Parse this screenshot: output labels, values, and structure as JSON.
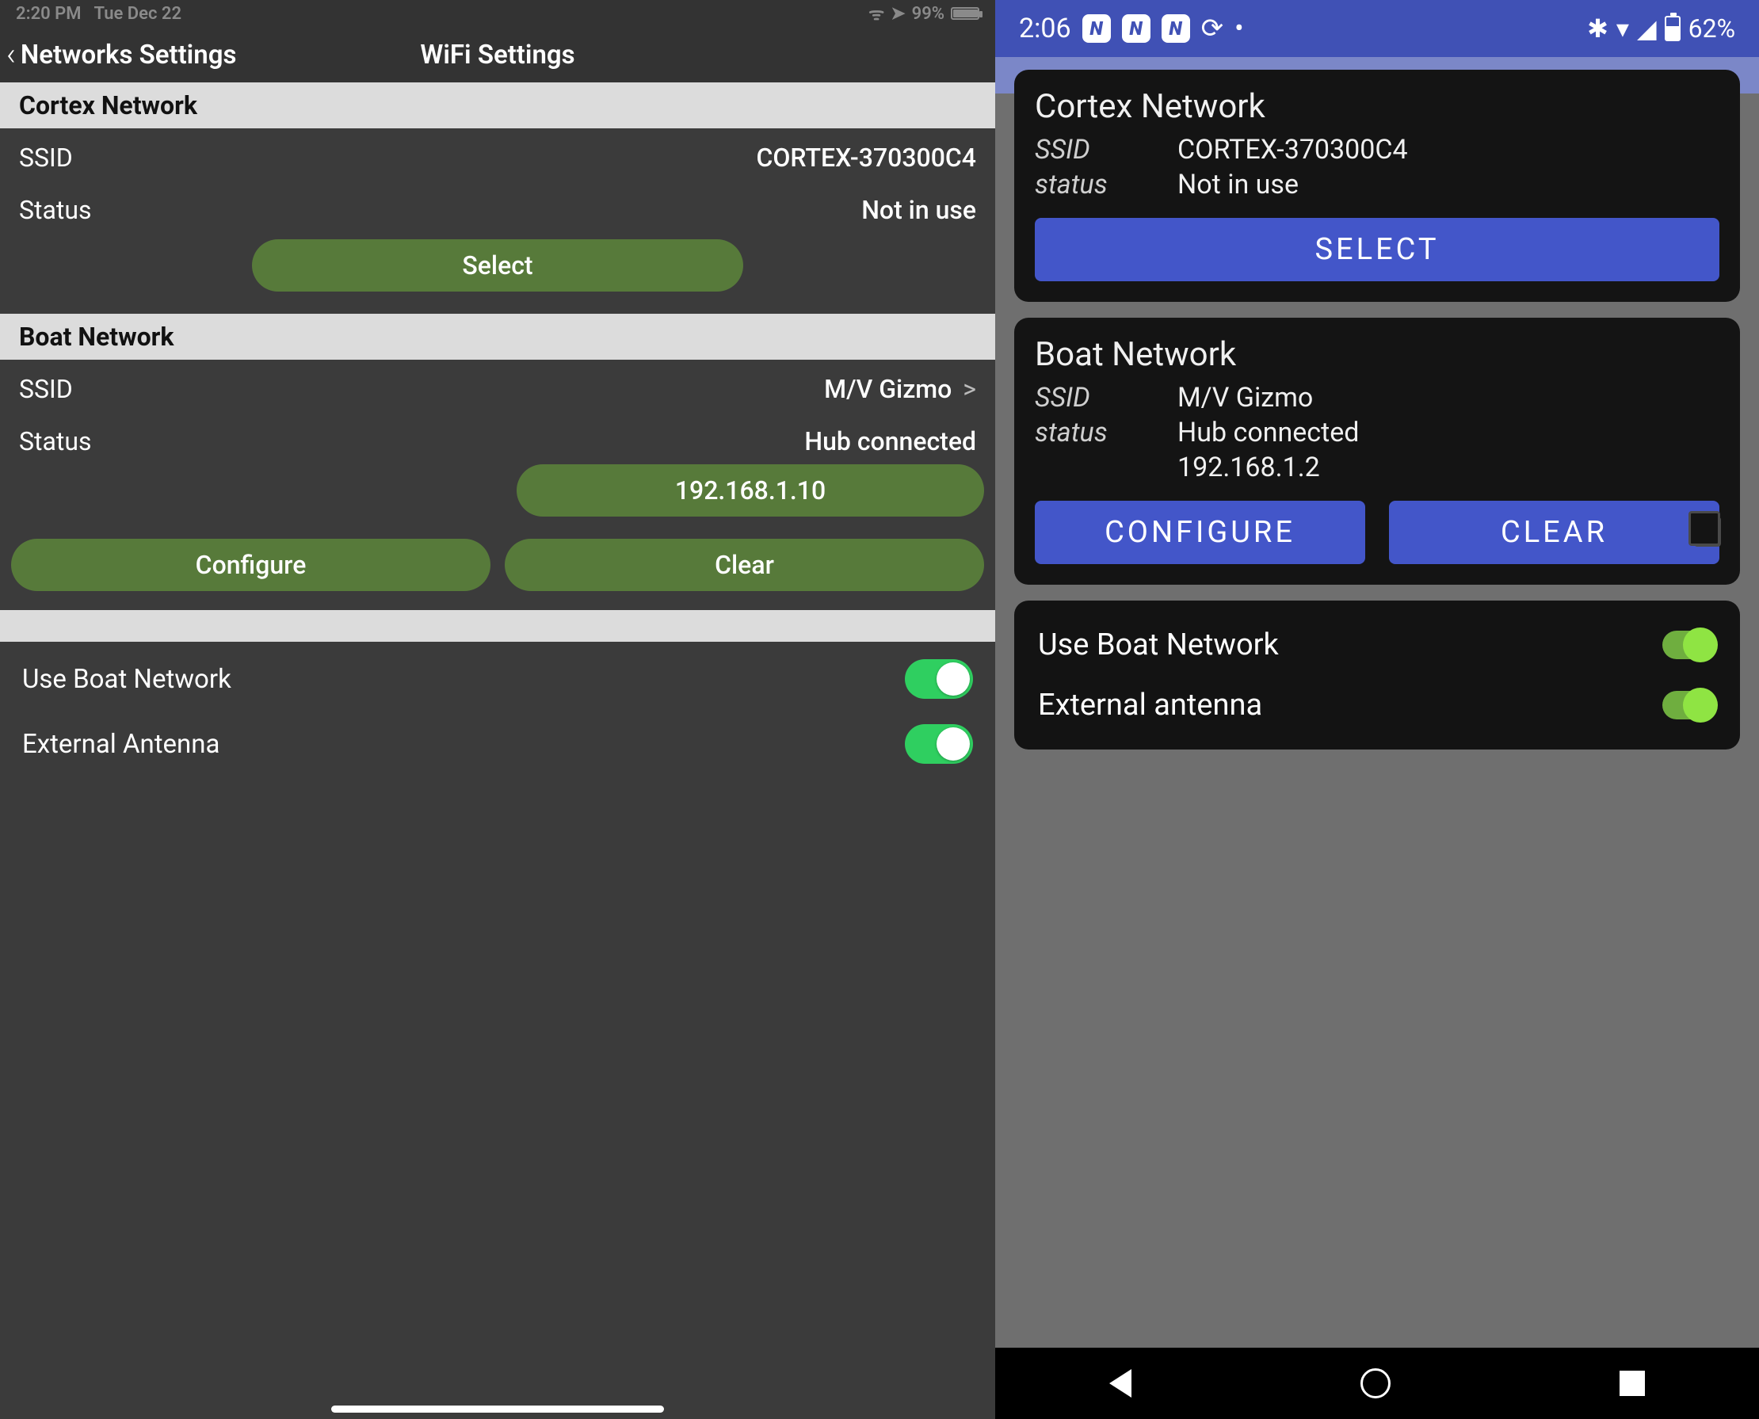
{
  "left": {
    "status": {
      "time": "2:20 PM",
      "date": "Tue Dec 22",
      "battery": "99%"
    },
    "nav": {
      "back": "Networks Settings",
      "title": "WiFi Settings"
    },
    "cortex": {
      "header": "Cortex Network",
      "ssid_label": "SSID",
      "ssid_value": "CORTEX-370300C4",
      "status_label": "Status",
      "status_value": "Not in use",
      "select_btn": "Select"
    },
    "boat": {
      "header": "Boat Network",
      "ssid_label": "SSID",
      "ssid_value": "M/V Gizmo",
      "status_label": "Status",
      "status_value": "Hub connected",
      "ip_btn": "192.168.1.10",
      "configure_btn": "Configure",
      "clear_btn": "Clear"
    },
    "toggles": {
      "use_boat": "Use Boat Network",
      "ext_antenna": "External Antenna"
    }
  },
  "right": {
    "status": {
      "time": "2:06",
      "battery": "62%"
    },
    "cortex": {
      "title": "Cortex Network",
      "ssid_label": "SSID",
      "ssid_value": "CORTEX-370300C4",
      "status_label": "status",
      "status_value": "Not in use",
      "select_btn": "SELECT"
    },
    "boat": {
      "title": "Boat Network",
      "ssid_label": "SSID",
      "ssid_value": "M/V Gizmo",
      "status_label": "status",
      "status_value": "Hub connected",
      "ip": "192.168.1.2",
      "configure_btn": "CONFIGURE",
      "clear_btn": "CLEAR"
    },
    "toggles": {
      "use_boat": "Use Boat Network",
      "ext_antenna": "External antenna"
    }
  }
}
